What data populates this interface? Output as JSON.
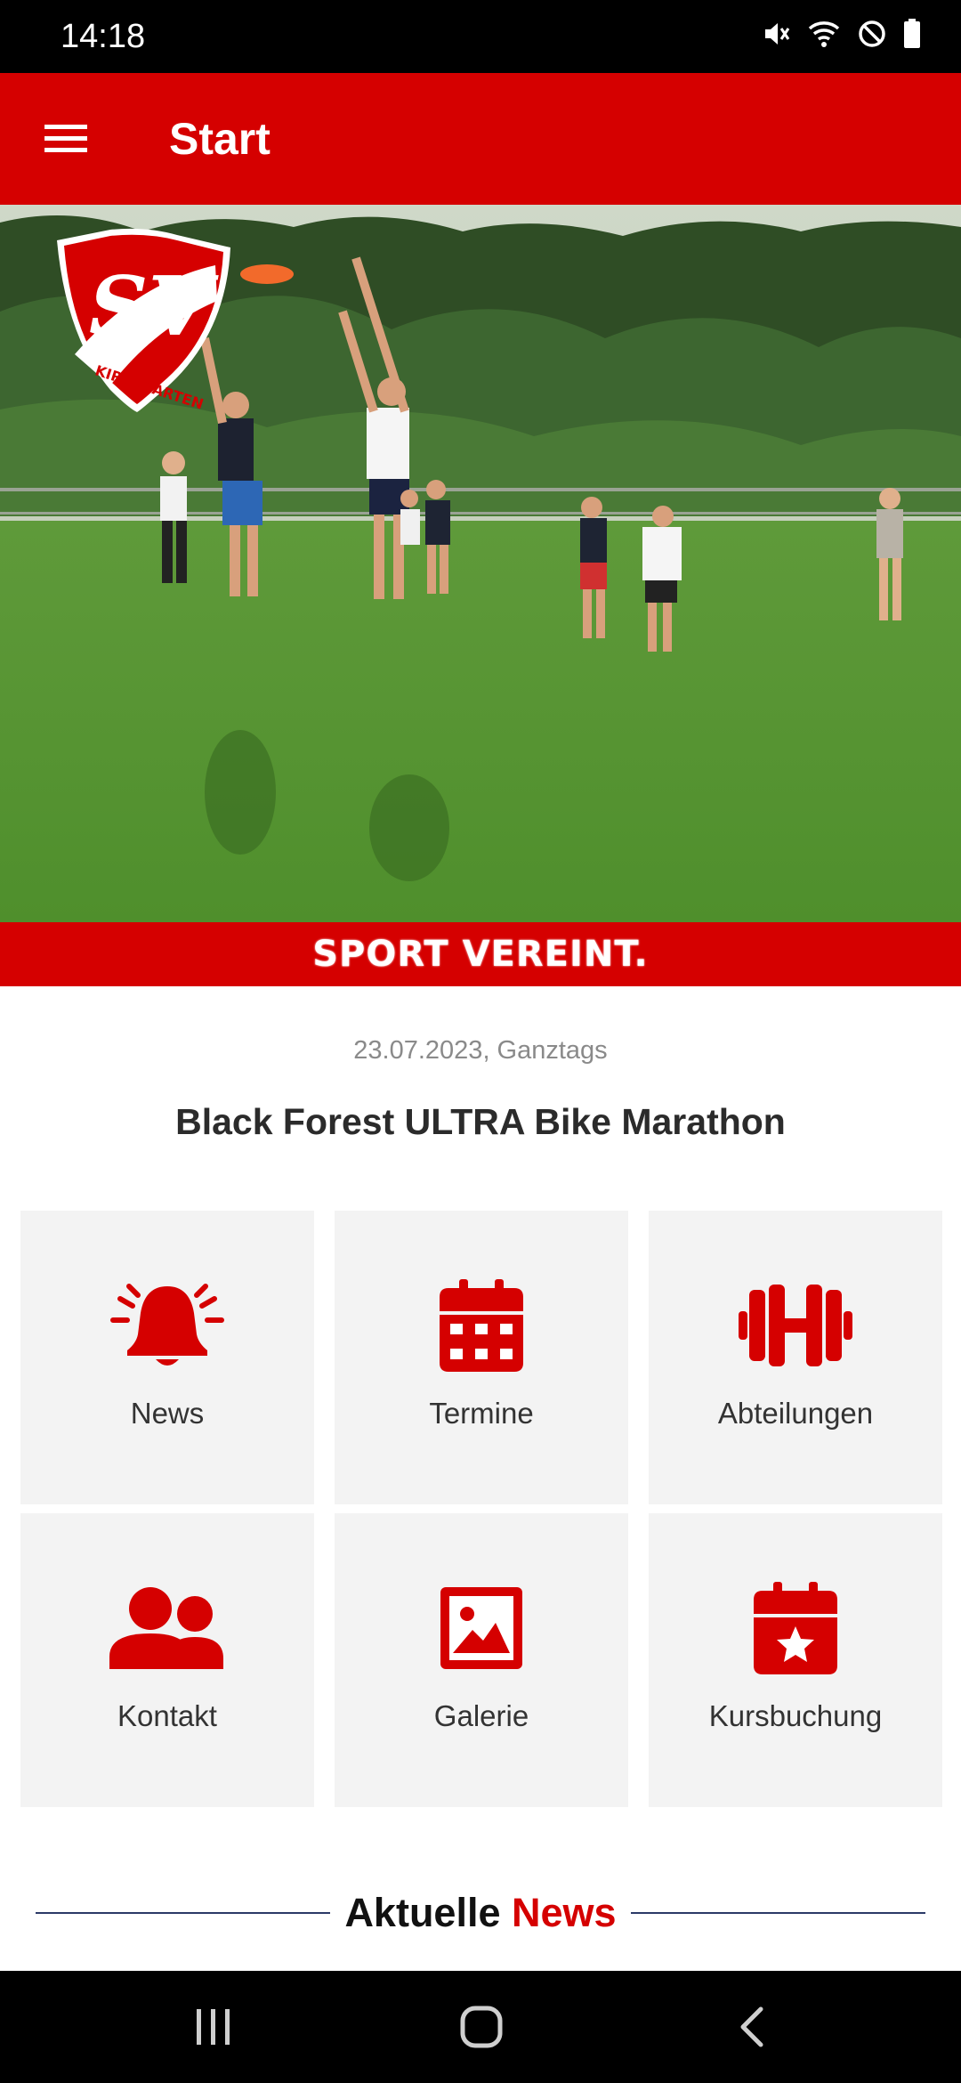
{
  "status_bar": {
    "time": "14:18"
  },
  "app_bar": {
    "title": "Start"
  },
  "hero": {
    "logo_text": "KIRCHZARTEN",
    "logo_letters": "SV",
    "slogan": "SPORT VEREINT."
  },
  "event": {
    "date": "23.07.2023, Ganztags",
    "title": "Black Forest ULTRA Bike Marathon"
  },
  "tiles": [
    {
      "label": "News",
      "icon": "bell-icon"
    },
    {
      "label": "Termine",
      "icon": "calendar-icon"
    },
    {
      "label": "Abteilungen",
      "icon": "dumbbell-icon"
    },
    {
      "label": "Kontakt",
      "icon": "users-icon"
    },
    {
      "label": "Galerie",
      "icon": "image-icon"
    },
    {
      "label": "Kursbuchung",
      "icon": "calendar-star-icon"
    }
  ],
  "news_section": {
    "heading_prefix": "Aktuelle",
    "heading_accent": "News"
  },
  "colors": {
    "primary": "#d50000",
    "tile_bg": "#f3f3f3",
    "text": "#333333",
    "line": "#2b3a67"
  }
}
